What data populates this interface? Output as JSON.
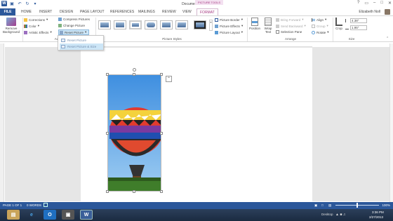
{
  "window": {
    "title": "Document1 - Word",
    "contextual_group": "PICTURE TOOLS",
    "user": "Elizabeth Noll"
  },
  "tabs": [
    "FILE",
    "HOME",
    "INSERT",
    "DESIGN",
    "PAGE LAYOUT",
    "REFERENCES",
    "MAILINGS",
    "REVIEW",
    "VIEW",
    "FORMAT"
  ],
  "ribbon": {
    "remove_bg": "Remove\nBackground",
    "adjust": {
      "corrections": "Corrections",
      "color": "Color",
      "artistic": "Artistic Effects",
      "compress": "Compress Pictures",
      "change": "Change Picture",
      "reset": "Reset Picture",
      "label": "Adjust"
    },
    "styles": {
      "label": "Picture Styles",
      "border": "Picture Border",
      "effects": "Picture Effects",
      "layout": "Picture Layout"
    },
    "arrange": {
      "position": "Position",
      "wrap": "Wrap\nText",
      "bring_forward": "Bring Forward",
      "send_backward": "Send Backward",
      "selection_pane": "Selection Pane",
      "align": "Align",
      "group": "Group",
      "rotate": "Rotate",
      "label": "Arrange"
    },
    "size": {
      "crop": "Crop",
      "height": "4.38\"",
      "width": "1.95\"",
      "label": "Size"
    }
  },
  "dropdown": {
    "items": [
      "Reset Picture",
      "Reset Picture & Size"
    ]
  },
  "status": {
    "page": "PAGE 1 OF 1",
    "words": "0 WORDS",
    "zoom": "100%"
  },
  "taskbar": {
    "desktop": "Desktop",
    "time": "3:36 PM",
    "date": "2/27/2013"
  }
}
